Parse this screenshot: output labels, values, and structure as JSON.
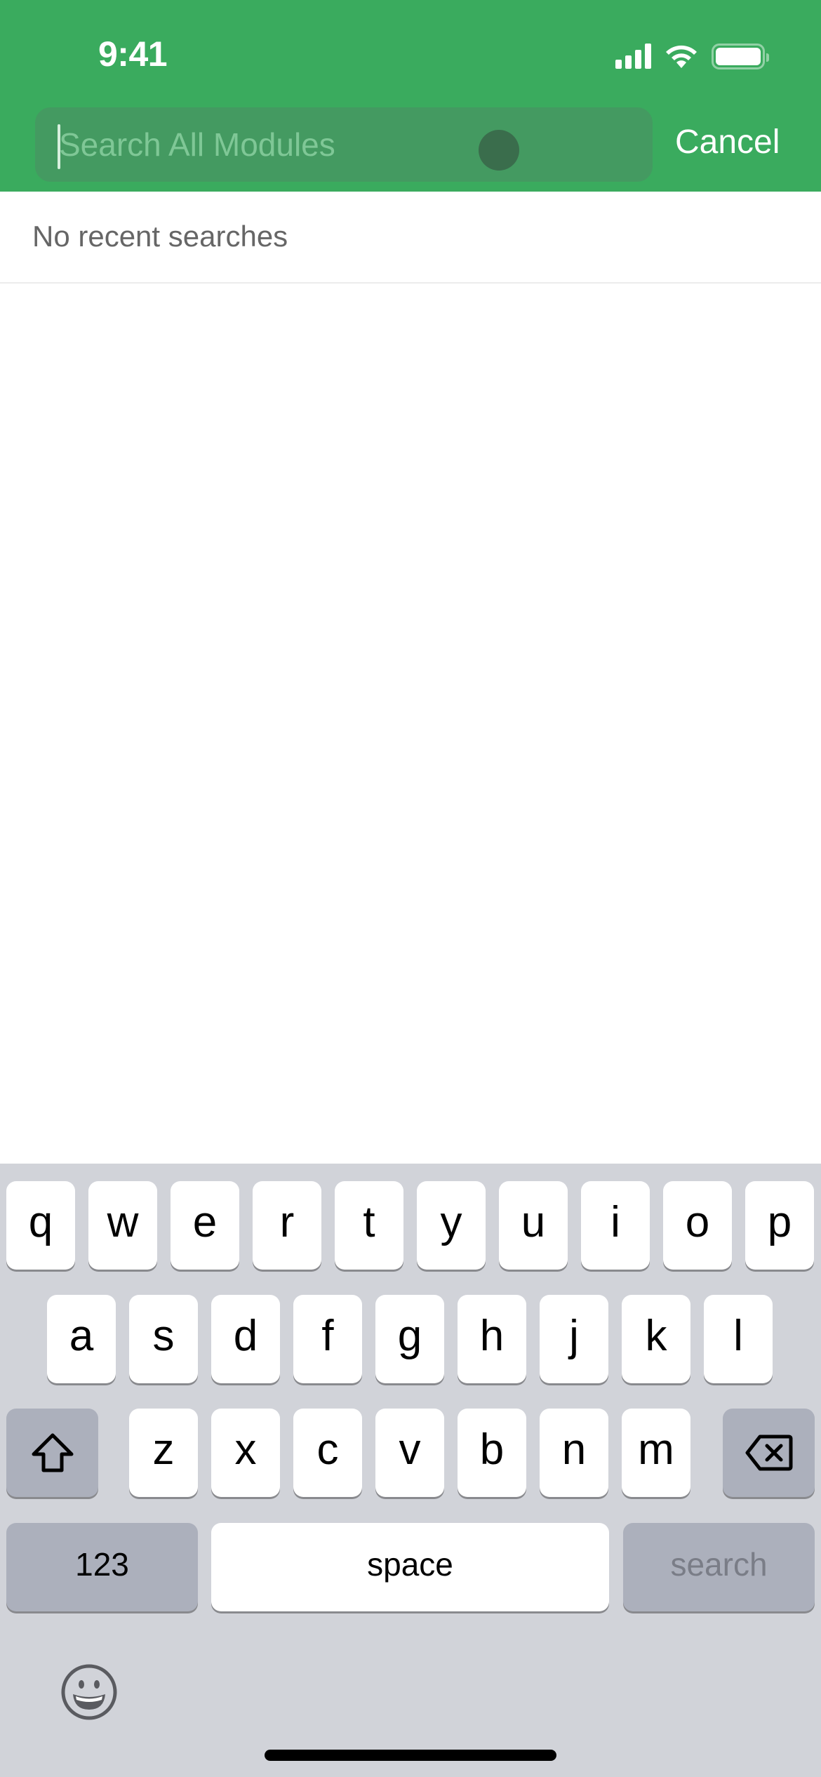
{
  "status_bar": {
    "time": "9:41",
    "signal_icon": "cellular-signal-icon",
    "wifi_icon": "wifi-icon",
    "battery_icon": "battery-full-icon"
  },
  "header": {
    "background_color": "#3aab5e",
    "search": {
      "value": "",
      "placeholder": "Search All Modules"
    },
    "cancel_label": "Cancel"
  },
  "recent": {
    "empty_text": "No recent searches"
  },
  "keyboard": {
    "row1": [
      "q",
      "w",
      "e",
      "r",
      "t",
      "y",
      "u",
      "i",
      "o",
      "p"
    ],
    "row2": [
      "a",
      "s",
      "d",
      "f",
      "g",
      "h",
      "j",
      "k",
      "l"
    ],
    "row3": [
      "z",
      "x",
      "c",
      "v",
      "b",
      "n",
      "m"
    ],
    "shift_icon": "shift-arrow-icon",
    "backspace_icon": "delete-backward-icon",
    "numbers_label": "123",
    "space_label": "space",
    "return_label": "search",
    "emoji_icon": "emoji-smiley-icon"
  }
}
